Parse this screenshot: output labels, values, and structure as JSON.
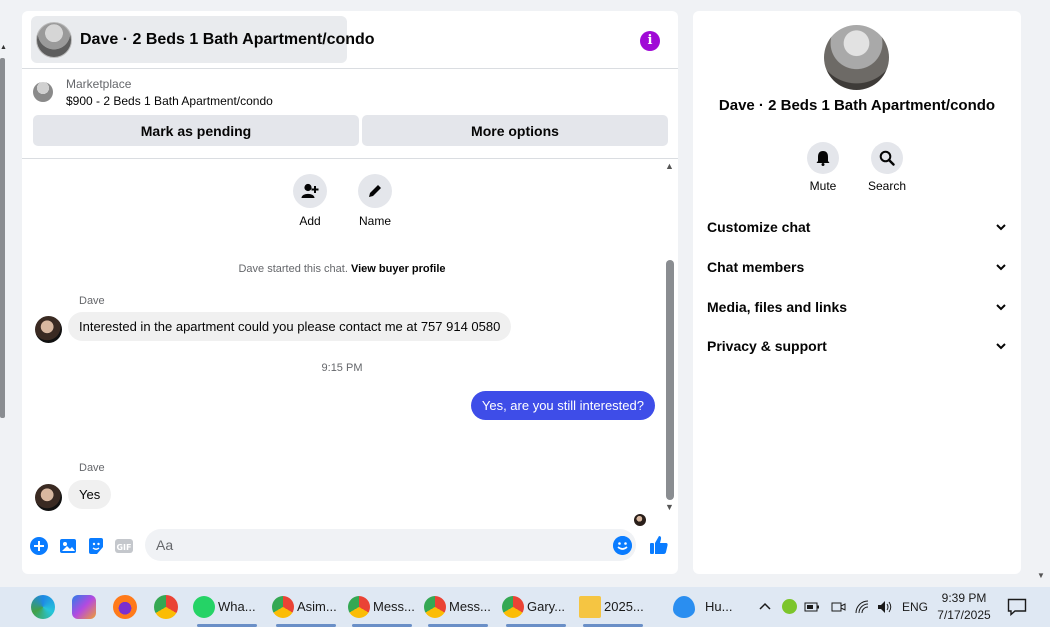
{
  "chat": {
    "title": "Dave · 2 Beds 1 Bath Apartment/condo",
    "marketplace_label": "Marketplace",
    "listing": "$900 - 2 Beds 1 Bath Apartment/condo",
    "mark_pending_label": "Mark as pending",
    "more_options_label": "More options",
    "actions": {
      "add": "Add",
      "name": "Name"
    },
    "started_text": "Dave started this chat.",
    "view_profile_link": "View buyer profile",
    "messages": [
      {
        "sender": "Dave",
        "text": "Interested in the apartment could you please contact me at 757 914 0580"
      },
      {
        "timestamp": "9:15 PM"
      },
      {
        "text": "Yes, are you still interested?"
      },
      {
        "sender": "Dave",
        "text": "Yes"
      }
    ],
    "composer_placeholder": "Aa"
  },
  "info_panel": {
    "title": "Dave · 2 Beds 1 Bath Apartment/condo",
    "mute_label": "Mute",
    "search_label": "Search",
    "sections": [
      "Customize chat",
      "Chat members",
      "Media, files and links",
      "Privacy & support"
    ]
  },
  "taskbar": {
    "apps": [
      "Wha...",
      "Asim...",
      "Mess...",
      "Mess...",
      "Gary...",
      "2025...",
      "Hu..."
    ],
    "language": "ENG",
    "time": "9:39 PM",
    "date": "7/17/2025"
  },
  "colors": {
    "accent": "#3e4de8",
    "info_icon": "#a00ad6",
    "composer_icons": "#0a7cff"
  }
}
